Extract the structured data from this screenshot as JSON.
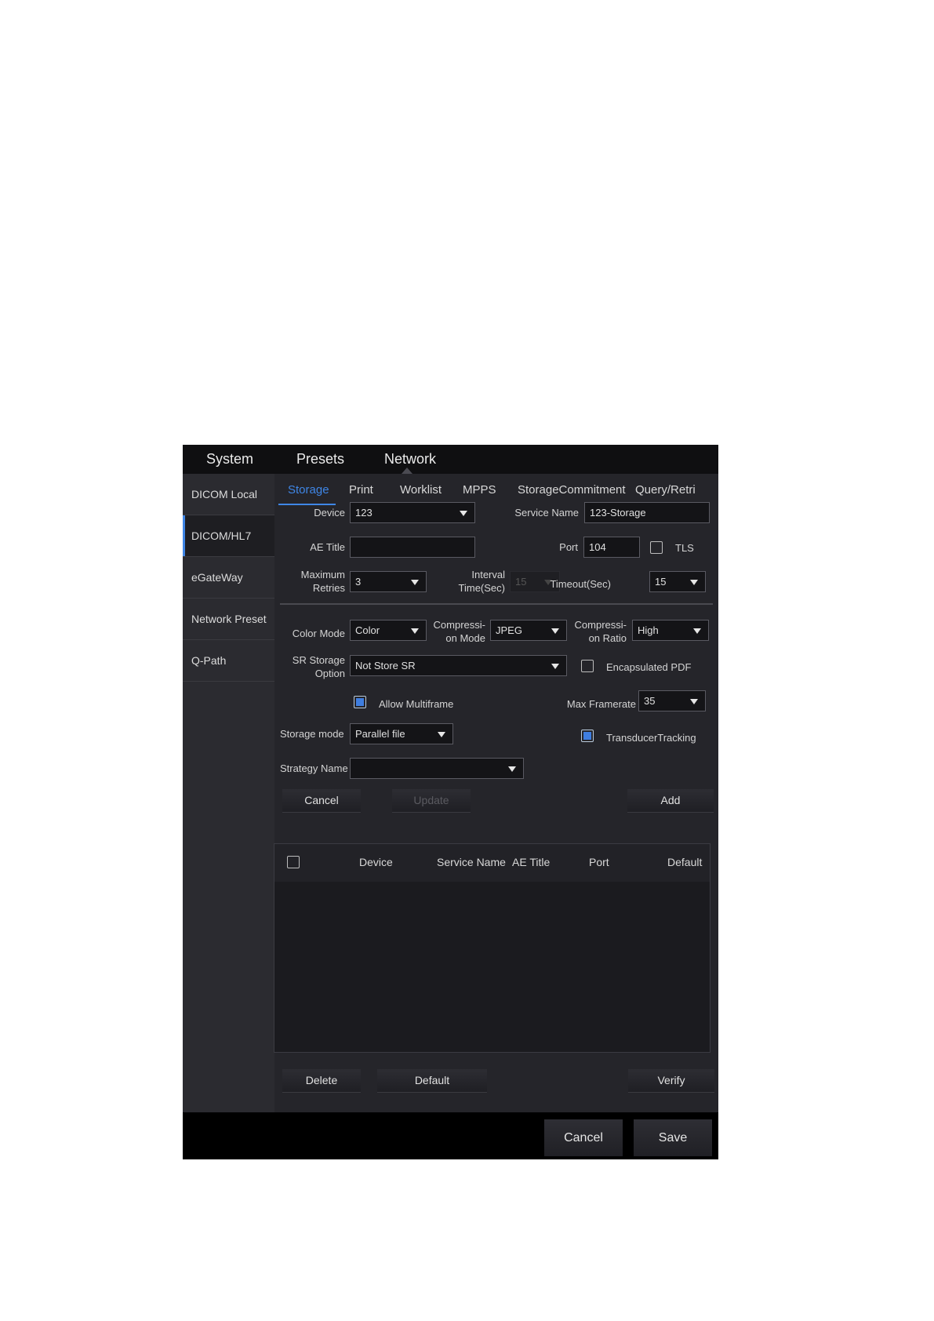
{
  "top_nav": {
    "tabs": [
      {
        "label": "System"
      },
      {
        "label": "Presets"
      },
      {
        "label": "Network"
      }
    ]
  },
  "sidebar": {
    "items": [
      {
        "label": "DICOM Local"
      },
      {
        "label": "DICOM/HL7"
      },
      {
        "label": "eGateWay"
      },
      {
        "label": "Network Preset"
      },
      {
        "label": "Q-Path"
      }
    ]
  },
  "sub_tabs": [
    {
      "label": "Storage"
    },
    {
      "label": "Print"
    },
    {
      "label": "Worklist"
    },
    {
      "label": "MPPS"
    },
    {
      "label": "StorageCommitment"
    },
    {
      "label": "Query/Retri"
    }
  ],
  "form": {
    "device": {
      "label": "Device",
      "value": "123"
    },
    "service_name": {
      "label": "Service Name",
      "value": "123-Storage"
    },
    "ae_title": {
      "label": "AE Title",
      "value": ""
    },
    "port": {
      "label": "Port",
      "value": "104"
    },
    "tls": {
      "label": "TLS",
      "checked": false
    },
    "max_retries": {
      "label_line1": "Maximum",
      "label_line2": "Retries",
      "value": "3"
    },
    "interval_time": {
      "label_line1": "Interval",
      "label_line2": "Time(Sec)",
      "value": "15"
    },
    "timeout": {
      "label": "Timeout(Sec)",
      "value": "15"
    },
    "color_mode": {
      "label": "Color Mode",
      "value": "Color"
    },
    "compression_mode": {
      "label_line1": "Compressi-",
      "label_line2": "on Mode",
      "value": "JPEG"
    },
    "compression_ratio": {
      "label_line1": "Compressi-",
      "label_line2": "on Ratio",
      "value": "High"
    },
    "sr_storage": {
      "label_line1": "SR Storage",
      "label_line2": "Option",
      "value": "Not Store SR"
    },
    "encapsulated_pdf": {
      "label": "Encapsulated PDF",
      "checked": false
    },
    "allow_multiframe": {
      "label": "Allow Multiframe",
      "checked": true
    },
    "max_framerate": {
      "label": "Max Framerate",
      "value": "35"
    },
    "storage_mode": {
      "label": "Storage mode",
      "value": "Parallel file"
    },
    "transducer_tracking": {
      "label": "TransducerTracking",
      "checked": true
    },
    "strategy_name": {
      "label": "Strategy Name",
      "value": ""
    }
  },
  "actions": {
    "cancel": "Cancel",
    "update": "Update",
    "add": "Add"
  },
  "table": {
    "columns": [
      "Device",
      "Service Name",
      "AE Title",
      "Port",
      "Default"
    ],
    "rows": []
  },
  "table_actions": {
    "delete": "Delete",
    "default": "Default",
    "verify": "Verify"
  },
  "footer": {
    "cancel": "Cancel",
    "save": "Save"
  },
  "colors": {
    "accent": "#3f86e6",
    "background": "#1c1c20",
    "panel": "#25252a"
  }
}
